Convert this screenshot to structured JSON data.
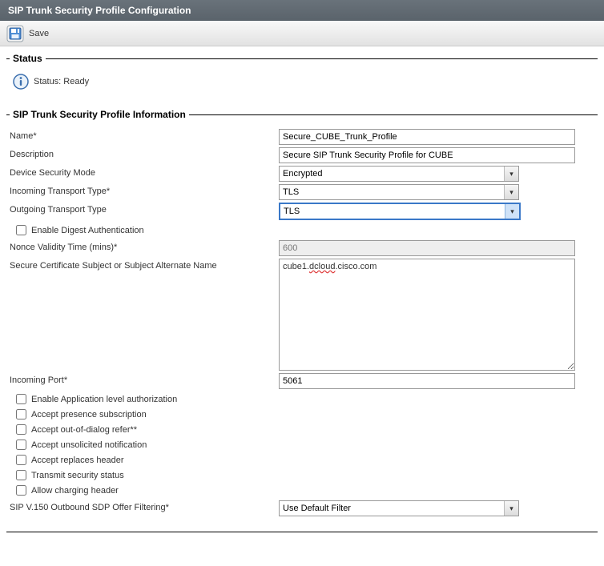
{
  "titleBar": "SIP Trunk Security Profile Configuration",
  "toolbar": {
    "save": "Save"
  },
  "statusGroup": {
    "legend": "Status",
    "text": "Status: Ready"
  },
  "infoGroup": {
    "legend": "SIP Trunk Security Profile Information",
    "labels": {
      "name": "Name",
      "description": "Description",
      "deviceSecurityMode": "Device Security Mode",
      "incomingTransport": "Incoming Transport Type",
      "outgoingTransport": "Outgoing Transport Type",
      "enableDigest": "Enable Digest Authentication",
      "nonce": "Nonce Validity Time (mins)",
      "certSubject": "Secure Certificate Subject or Subject Alternate Name",
      "incomingPort": "Incoming Port",
      "enableAppAuth": "Enable Application level authorization",
      "acceptPresence": "Accept presence subscription",
      "acceptRefer": "Accept out-of-dialog refer",
      "acceptUnsolicited": "Accept unsolicited notification",
      "acceptReplaces": "Accept replaces header",
      "transmitSecurity": "Transmit security status",
      "allowCharging": "Allow charging header",
      "sdpFilter": "SIP V.150 Outbound SDP Offer Filtering"
    },
    "values": {
      "name": "Secure_CUBE_Trunk_Profile",
      "description": "Secure SIP Trunk Security Profile for CUBE",
      "deviceSecurityMode": "Encrypted",
      "incomingTransport": "TLS",
      "outgoingTransport": "TLS",
      "nonce": "600",
      "certSubject1": "cube1.",
      "certSubject2": "dcloud",
      "certSubject3": ".cisco.com",
      "incomingPort": "5061",
      "sdpFilter": "Use Default Filter"
    }
  }
}
